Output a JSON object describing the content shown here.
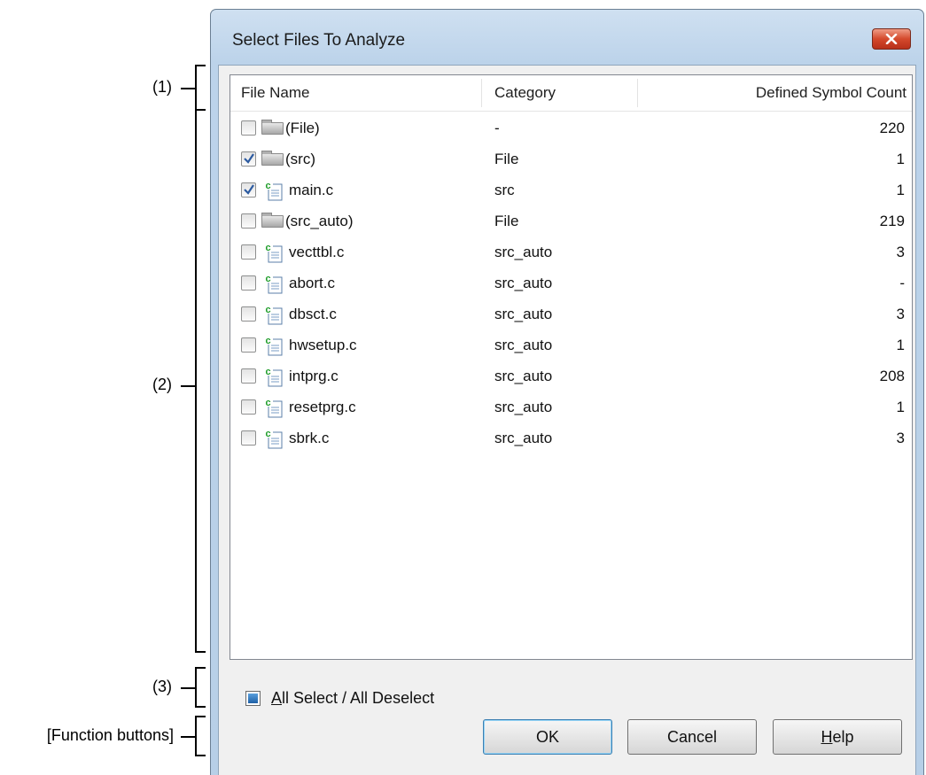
{
  "annotations": {
    "header": "(1)",
    "list": "(2)",
    "select_all": "(3)",
    "function_buttons": "[Function buttons]"
  },
  "window": {
    "title": "Select Files To Analyze",
    "close_icon": "close-x-icon"
  },
  "list": {
    "columns": [
      "File Name",
      "Category",
      "Defined Symbol Count"
    ],
    "rows": [
      {
        "checked": false,
        "icon": "folder",
        "indent": 0,
        "name": "(File)",
        "category": "-",
        "count": "220"
      },
      {
        "checked": true,
        "icon": "folder",
        "indent": 0,
        "name": "(src)",
        "category": "File",
        "count": "1"
      },
      {
        "checked": true,
        "icon": "c-file",
        "indent": 0,
        "name": "main.c",
        "category": "src",
        "count": "1"
      },
      {
        "checked": false,
        "icon": "folder",
        "indent": 0,
        "name": "(src_auto)",
        "category": "File",
        "count": "219"
      },
      {
        "checked": false,
        "icon": "c-file",
        "indent": 0,
        "name": "vecttbl.c",
        "category": "src_auto",
        "count": "3"
      },
      {
        "checked": false,
        "icon": "c-file",
        "indent": 0,
        "name": "abort.c",
        "category": "src_auto",
        "count": "-"
      },
      {
        "checked": false,
        "icon": "c-file",
        "indent": 0,
        "name": "dbsct.c",
        "category": "src_auto",
        "count": "3"
      },
      {
        "checked": false,
        "icon": "c-file",
        "indent": 0,
        "name": "hwsetup.c",
        "category": "src_auto",
        "count": "1"
      },
      {
        "checked": false,
        "icon": "c-file",
        "indent": 0,
        "name": "intprg.c",
        "category": "src_auto",
        "count": "208"
      },
      {
        "checked": false,
        "icon": "c-file",
        "indent": 0,
        "name": "resetprg.c",
        "category": "src_auto",
        "count": "1"
      },
      {
        "checked": false,
        "icon": "c-file",
        "indent": 0,
        "name": "sbrk.c",
        "category": "src_auto",
        "count": "3"
      }
    ]
  },
  "select_all": {
    "label_underlined": "A",
    "label_rest": "ll Select / All Deselect",
    "state": "indeterminate"
  },
  "buttons": {
    "ok": "OK",
    "cancel": "Cancel",
    "help_underlined": "H",
    "help_rest": "elp"
  }
}
